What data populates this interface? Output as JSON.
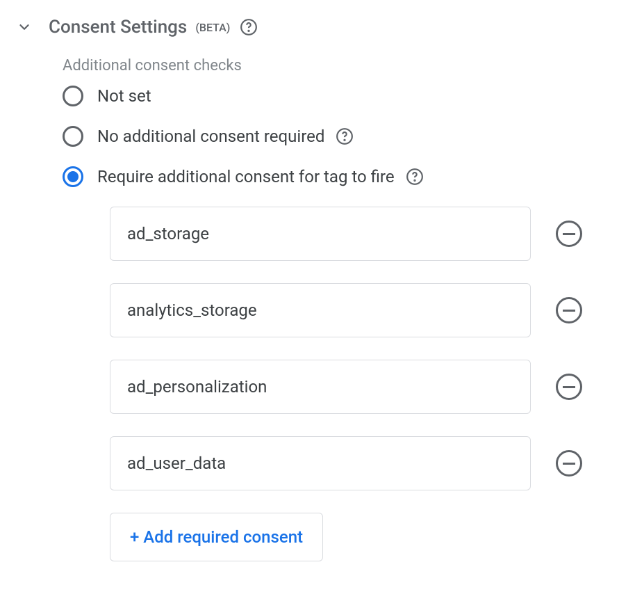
{
  "section": {
    "title": "Consent Settings",
    "beta_label": "(BETA)"
  },
  "subsection": {
    "label": "Additional consent checks"
  },
  "radios": {
    "option1": {
      "label": "Not set",
      "selected": false
    },
    "option2": {
      "label": "No additional consent required",
      "selected": false
    },
    "option3": {
      "label": "Require additional consent for tag to fire",
      "selected": true
    }
  },
  "consent_items": [
    "ad_storage",
    "analytics_storage",
    "ad_personalization",
    "ad_user_data"
  ],
  "add_button_label": "+ Add required consent"
}
